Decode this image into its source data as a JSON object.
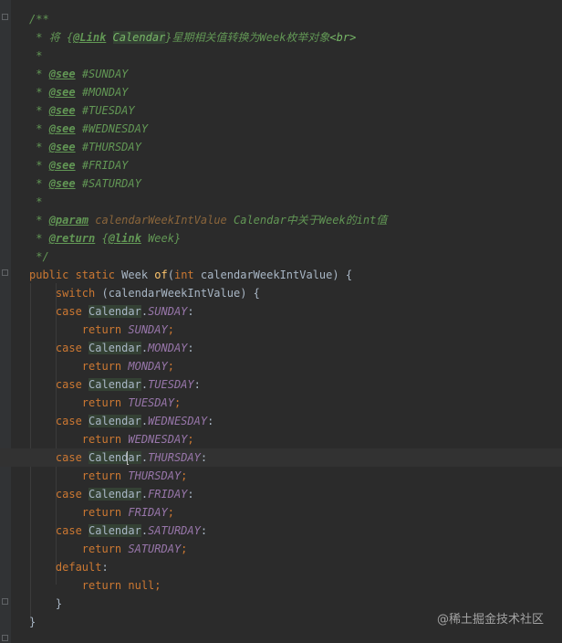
{
  "editor": {
    "lines": [
      [
        {
          "cls": "t-doc",
          "text": "/**"
        }
      ],
      [
        {
          "cls": "t-doc",
          "text": " * 将 "
        },
        {
          "cls": "t-doc",
          "text": "{"
        },
        {
          "cls": "t-tag",
          "text": "@Link"
        },
        {
          "cls": "t-doc",
          "text": " "
        },
        {
          "cls": "t-ref",
          "text": "Calendar"
        },
        {
          "cls": "t-doc",
          "text": "}星期相关值转换为Week枚举对象"
        },
        {
          "cls": "t-html",
          "text": "<br>"
        }
      ],
      [
        {
          "cls": "t-doc",
          "text": " *"
        }
      ],
      [
        {
          "cls": "t-doc",
          "text": " * "
        },
        {
          "cls": "t-tag",
          "text": "@see"
        },
        {
          "cls": "t-doc",
          "text": " #SUNDAY"
        }
      ],
      [
        {
          "cls": "t-doc",
          "text": " * "
        },
        {
          "cls": "t-tag",
          "text": "@see"
        },
        {
          "cls": "t-doc",
          "text": " #MONDAY"
        }
      ],
      [
        {
          "cls": "t-doc",
          "text": " * "
        },
        {
          "cls": "t-tag",
          "text": "@see"
        },
        {
          "cls": "t-doc",
          "text": " #TUESDAY"
        }
      ],
      [
        {
          "cls": "t-doc",
          "text": " * "
        },
        {
          "cls": "t-tag",
          "text": "@see"
        },
        {
          "cls": "t-doc",
          "text": " #WEDNESDAY"
        }
      ],
      [
        {
          "cls": "t-doc",
          "text": " * "
        },
        {
          "cls": "t-tag",
          "text": "@see"
        },
        {
          "cls": "t-doc",
          "text": " #THURSDAY"
        }
      ],
      [
        {
          "cls": "t-doc",
          "text": " * "
        },
        {
          "cls": "t-tag",
          "text": "@see"
        },
        {
          "cls": "t-doc",
          "text": " #FRIDAY"
        }
      ],
      [
        {
          "cls": "t-doc",
          "text": " * "
        },
        {
          "cls": "t-tag",
          "text": "@see"
        },
        {
          "cls": "t-doc",
          "text": " #SATURDAY"
        }
      ],
      [
        {
          "cls": "t-doc",
          "text": " *"
        }
      ],
      [
        {
          "cls": "t-doc",
          "text": " * "
        },
        {
          "cls": "t-tag",
          "text": "@param"
        },
        {
          "cls": "t-doc",
          "text": " "
        },
        {
          "cls": "t-param",
          "text": "calendarWeekIntValue"
        },
        {
          "cls": "t-doc",
          "text": " Calendar中关于Week的int值"
        }
      ],
      [
        {
          "cls": "t-doc",
          "text": " * "
        },
        {
          "cls": "t-tag",
          "text": "@return"
        },
        {
          "cls": "t-doc",
          "text": " {"
        },
        {
          "cls": "t-tag",
          "text": "@link"
        },
        {
          "cls": "t-doc",
          "text": " Week}"
        }
      ],
      [
        {
          "cls": "t-doc",
          "text": " */"
        }
      ],
      [
        {
          "cls": "t-kw",
          "text": "public static "
        },
        {
          "cls": "t-id",
          "text": "Week "
        },
        {
          "cls": "t-method",
          "text": "of"
        },
        {
          "cls": "t-id",
          "text": "("
        },
        {
          "cls": "t-kw",
          "text": "int "
        },
        {
          "cls": "t-id",
          "text": "calendarWeekIntValue) {"
        }
      ],
      [
        {
          "cls": "t-id",
          "text": "    "
        },
        {
          "cls": "t-kw",
          "text": "switch "
        },
        {
          "cls": "t-id",
          "text": "(calendarWeekIntValue) {"
        }
      ],
      [
        {
          "cls": "t-id",
          "text": "    "
        },
        {
          "cls": "t-kw",
          "text": "case "
        },
        {
          "cls": "t-cal",
          "text": "Calendar"
        },
        {
          "cls": "t-id",
          "text": "."
        },
        {
          "cls": "t-const",
          "text": "SUNDAY"
        },
        {
          "cls": "t-id",
          "text": ":"
        }
      ],
      [
        {
          "cls": "t-id",
          "text": "        "
        },
        {
          "cls": "t-kw",
          "text": "return "
        },
        {
          "cls": "t-const",
          "text": "SUNDAY"
        },
        {
          "cls": "t-kw",
          "text": ";"
        }
      ],
      [
        {
          "cls": "t-id",
          "text": "    "
        },
        {
          "cls": "t-kw",
          "text": "case "
        },
        {
          "cls": "t-cal",
          "text": "Calendar"
        },
        {
          "cls": "t-id",
          "text": "."
        },
        {
          "cls": "t-const",
          "text": "MONDAY"
        },
        {
          "cls": "t-id",
          "text": ":"
        }
      ],
      [
        {
          "cls": "t-id",
          "text": "        "
        },
        {
          "cls": "t-kw",
          "text": "return "
        },
        {
          "cls": "t-const",
          "text": "MONDAY"
        },
        {
          "cls": "t-kw",
          "text": ";"
        }
      ],
      [
        {
          "cls": "t-id",
          "text": "    "
        },
        {
          "cls": "t-kw",
          "text": "case "
        },
        {
          "cls": "t-cal",
          "text": "Calendar"
        },
        {
          "cls": "t-id",
          "text": "."
        },
        {
          "cls": "t-const",
          "text": "TUESDAY"
        },
        {
          "cls": "t-id",
          "text": ":"
        }
      ],
      [
        {
          "cls": "t-id",
          "text": "        "
        },
        {
          "cls": "t-kw",
          "text": "return "
        },
        {
          "cls": "t-const",
          "text": "TUESDAY"
        },
        {
          "cls": "t-kw",
          "text": ";"
        }
      ],
      [
        {
          "cls": "t-id",
          "text": "    "
        },
        {
          "cls": "t-kw",
          "text": "case "
        },
        {
          "cls": "t-cal",
          "text": "Calendar"
        },
        {
          "cls": "t-id",
          "text": "."
        },
        {
          "cls": "t-const",
          "text": "WEDNESDAY"
        },
        {
          "cls": "t-id",
          "text": ":"
        }
      ],
      [
        {
          "cls": "t-id",
          "text": "        "
        },
        {
          "cls": "t-kw",
          "text": "return "
        },
        {
          "cls": "t-const",
          "text": "WEDNESDAY"
        },
        {
          "cls": "t-kw",
          "text": ";"
        }
      ],
      [
        {
          "cls": "t-id",
          "text": "    "
        },
        {
          "cls": "t-kw",
          "text": "case "
        },
        {
          "cls": "t-cal",
          "text": "Calend"
        },
        {
          "cls": "caret",
          "text": ""
        },
        {
          "cls": "t-cal",
          "text": "ar"
        },
        {
          "cls": "t-id",
          "text": "."
        },
        {
          "cls": "t-const",
          "text": "THURSDAY"
        },
        {
          "cls": "t-id",
          "text": ":"
        }
      ],
      [
        {
          "cls": "t-id",
          "text": "        "
        },
        {
          "cls": "t-kw",
          "text": "return "
        },
        {
          "cls": "t-const",
          "text": "THURSDAY"
        },
        {
          "cls": "t-kw",
          "text": ";"
        }
      ],
      [
        {
          "cls": "t-id",
          "text": "    "
        },
        {
          "cls": "t-kw",
          "text": "case "
        },
        {
          "cls": "t-cal",
          "text": "Calendar"
        },
        {
          "cls": "t-id",
          "text": "."
        },
        {
          "cls": "t-const",
          "text": "FRIDAY"
        },
        {
          "cls": "t-id",
          "text": ":"
        }
      ],
      [
        {
          "cls": "t-id",
          "text": "        "
        },
        {
          "cls": "t-kw",
          "text": "return "
        },
        {
          "cls": "t-const",
          "text": "FRIDAY"
        },
        {
          "cls": "t-kw",
          "text": ";"
        }
      ],
      [
        {
          "cls": "t-id",
          "text": "    "
        },
        {
          "cls": "t-kw",
          "text": "case "
        },
        {
          "cls": "t-cal",
          "text": "Calendar"
        },
        {
          "cls": "t-id",
          "text": "."
        },
        {
          "cls": "t-const",
          "text": "SATURDAY"
        },
        {
          "cls": "t-id",
          "text": ":"
        }
      ],
      [
        {
          "cls": "t-id",
          "text": "        "
        },
        {
          "cls": "t-kw",
          "text": "return "
        },
        {
          "cls": "t-const",
          "text": "SATURDAY"
        },
        {
          "cls": "t-kw",
          "text": ";"
        }
      ],
      [
        {
          "cls": "t-id",
          "text": "    "
        },
        {
          "cls": "t-kw",
          "text": "default"
        },
        {
          "cls": "t-id",
          "text": ":"
        }
      ],
      [
        {
          "cls": "t-id",
          "text": "        "
        },
        {
          "cls": "t-kw",
          "text": "return null;"
        }
      ],
      [
        {
          "cls": "t-id",
          "text": "    }"
        }
      ],
      [
        {
          "cls": "t-id",
          "text": "}"
        }
      ]
    ],
    "current_line": 24
  },
  "watermark": "@稀土掘金技术社区",
  "colors": {
    "background": "#2b2b2b",
    "keyword": "#cc7832",
    "doc_comment": "#629755",
    "constant": "#9876aa",
    "method": "#ffc66d",
    "identifier": "#a9b7c6"
  }
}
